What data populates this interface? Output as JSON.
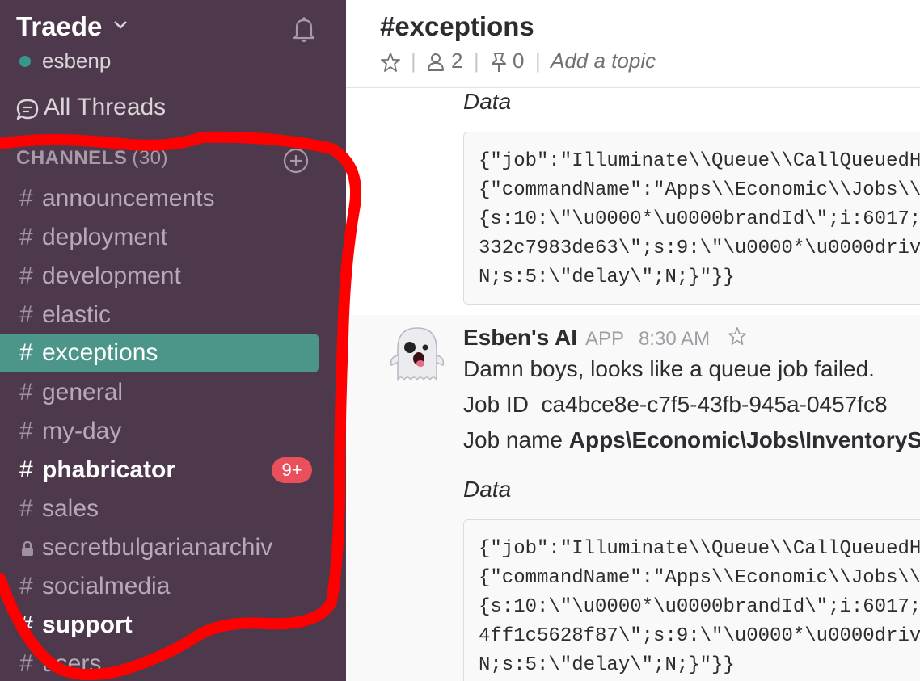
{
  "sidebar": {
    "team_name": "Traede",
    "username": "esbenp",
    "all_threads": "All Threads",
    "channels_header": "CHANNELS",
    "channels_count": "(30)",
    "channels": [
      {
        "name": "announcements",
        "state": "normal"
      },
      {
        "name": "deployment",
        "state": "normal"
      },
      {
        "name": "development",
        "state": "normal"
      },
      {
        "name": "elastic",
        "state": "normal"
      },
      {
        "name": "exceptions",
        "state": "active"
      },
      {
        "name": "general",
        "state": "normal"
      },
      {
        "name": "my-day",
        "state": "normal"
      },
      {
        "name": "phabricator",
        "state": "unread",
        "badge": "9+"
      },
      {
        "name": "sales",
        "state": "normal"
      },
      {
        "name": "secretbulgarianarchiv",
        "state": "private"
      },
      {
        "name": "socialmedia",
        "state": "normal"
      },
      {
        "name": "support",
        "state": "unread"
      },
      {
        "name": "users",
        "state": "normal"
      }
    ]
  },
  "header": {
    "channel_title": "#exceptions",
    "members": "2",
    "pins": "0",
    "topic_placeholder": "Add a topic"
  },
  "messages": {
    "first": {
      "data_label": "Data",
      "code_lines": [
        "{\"job\":\"Illuminate\\\\Queue\\\\CallQueuedH",
        "{\"commandName\":\"Apps\\\\Economic\\\\Jobs\\\\",
        "{s:10:\\\"\\u0000*\\u0000brandId\\\";i:6017;",
        "332c7983de63\\\";s:9:\\\"\\u0000*\\u0000driv",
        "N;s:5:\\\"delay\\\";N;}\"}}"
      ]
    },
    "second": {
      "sender": "Esben's AI",
      "app_tag": "APP",
      "time": "8:30 AM",
      "line1": "Damn boys, looks like a queue job failed.",
      "job_id_label": "Job ID",
      "job_id": "ca4bce8e-c7f5-43fb-945a-0457fc8",
      "job_name_label": "Job name",
      "job_name": "Apps\\Economic\\Jobs\\InventoryS",
      "data_label": "Data",
      "code_lines": [
        "{\"job\":\"Illuminate\\\\Queue\\\\CallQueuedH",
        "{\"commandName\":\"Apps\\\\Economic\\\\Jobs\\\\",
        "{s:10:\\\"\\u0000*\\u0000brandId\\\";i:6017;",
        "4ff1c5628f87\\\";s:9:\\\"\\u0000*\\u0000driv",
        "N;s:5:\\\"delay\\\";N;}\"}}"
      ]
    }
  },
  "colors": {
    "sidebar_bg": "#4d394b",
    "active_channel": "#4c9689",
    "presence": "#38978d",
    "badge": "#e9505b",
    "annotation": "#ff0000"
  },
  "icons": {
    "team_menu": "chevron-down-icon",
    "notifications": "bell-icon",
    "threads": "threads-icon",
    "add_channel": "plus-circle-icon",
    "private": "lock-icon",
    "star": "star-icon",
    "members": "person-icon",
    "pins": "pin-icon",
    "avatar": "ghost-emoji"
  }
}
